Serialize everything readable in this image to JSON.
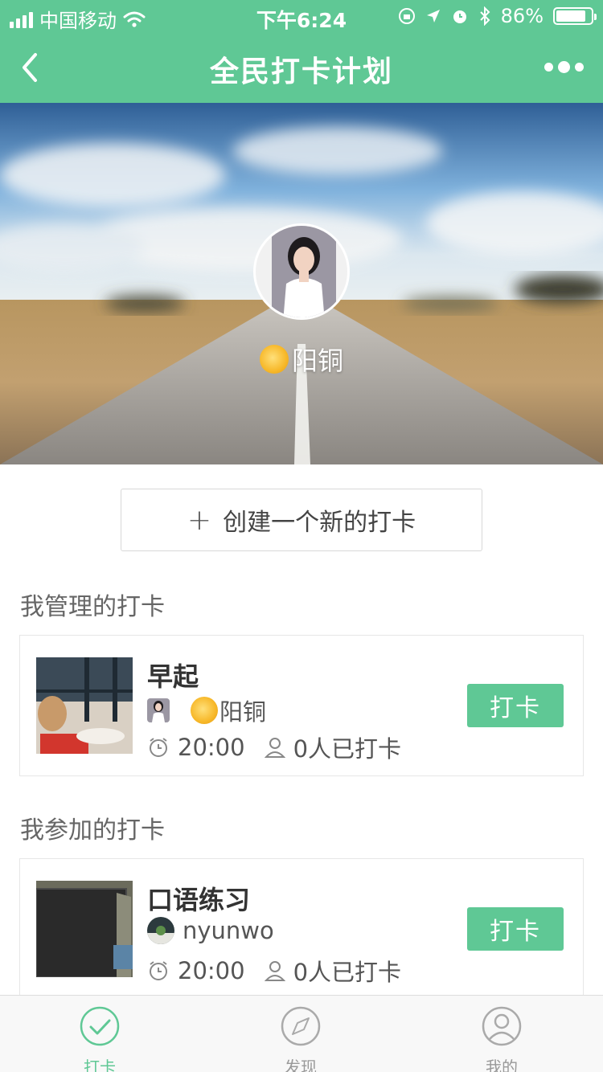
{
  "status_bar": {
    "carrier": "中国移动",
    "time": "下午6:24",
    "battery": "86%",
    "battery_level": 0.86
  },
  "nav": {
    "title": "全民打卡计划"
  },
  "hero": {
    "user_name": "阳铜"
  },
  "create_button": {
    "label": "创建一个新的打卡"
  },
  "managed": {
    "section_title": "我管理的打卡",
    "item": {
      "name": "早起",
      "owner": "阳铜",
      "time": "20:00",
      "count": "0人已打卡",
      "button": "打卡"
    }
  },
  "joined": {
    "section_title": "我参加的打卡",
    "item": {
      "name": "口语练习",
      "owner": "nyunwo",
      "time": "20:00",
      "count": "0人已打卡",
      "button": "打卡"
    }
  },
  "tabbar": {
    "tabs": [
      {
        "label": "打卡",
        "icon": "check-circle-icon",
        "active": true
      },
      {
        "label": "发现",
        "icon": "compass-icon",
        "active": false
      },
      {
        "label": "我的",
        "icon": "user-icon",
        "active": false
      }
    ]
  },
  "colors": {
    "accent": "#5fc895"
  }
}
